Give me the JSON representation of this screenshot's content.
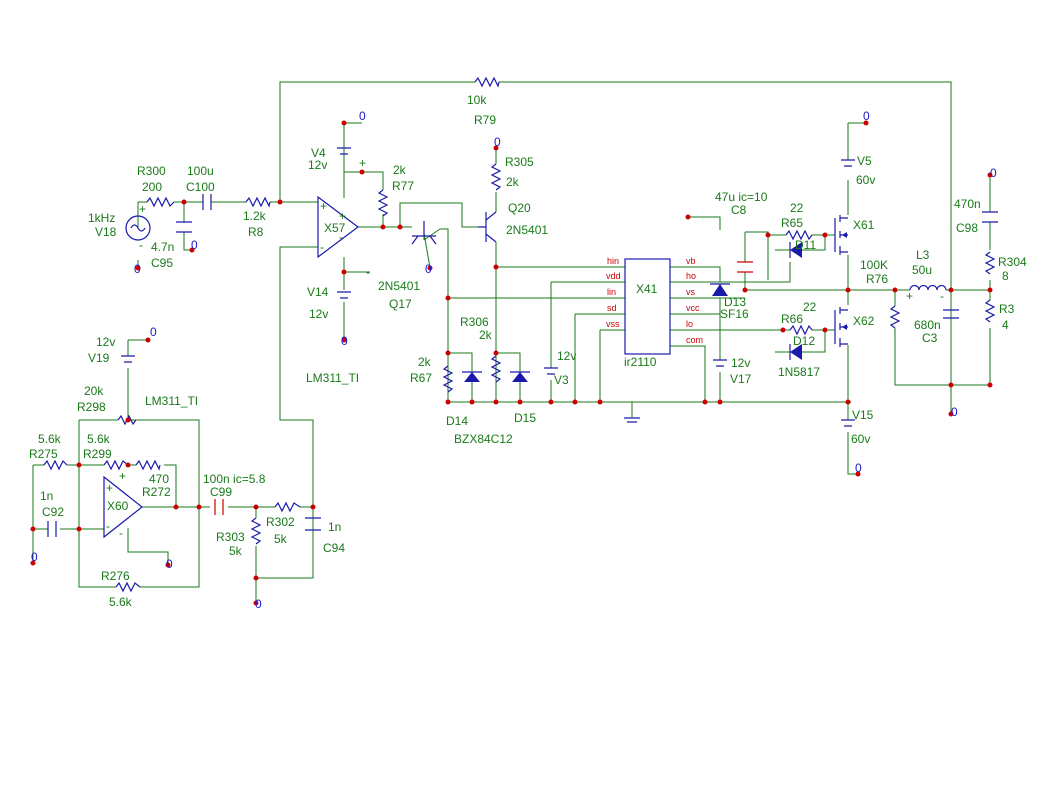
{
  "colors": {
    "wire": "#1a7a1a",
    "component": "#1a1aaa",
    "node": "#cc0000",
    "ground": "#1a1acc",
    "background": "#ffffff"
  },
  "labels": {
    "r300": "R300",
    "r300_val": "200",
    "c100_val": "100u",
    "c100": "C100",
    "v18_val": "1kHz",
    "v18": "V18",
    "c95_val": "4.7n",
    "c95": "C95",
    "r8_val": "1.2k",
    "r8": "R8",
    "v4": "V4",
    "v4_val": "12v",
    "v14": "V14",
    "v14_val": "12v",
    "r77_val": "2k",
    "r77": "R77",
    "x57": "X57",
    "lm311a": "LM311_TI",
    "r79_val": "10k",
    "r79": "R79",
    "r305": "R305",
    "r305_val": "2k",
    "q20": "Q20",
    "q20_val": "2N5401",
    "q17_val": "2N5401",
    "q17": "Q17",
    "r306": "R306",
    "r306_val": "2k",
    "r67_val": "2k",
    "r67": "R67",
    "d14": "D14",
    "d15": "D15",
    "bzx": "BZX84C12",
    "v3_val": "12v",
    "v3": "V3",
    "x41": "X41",
    "ir2110": "ir2110",
    "c8_val": "47u ic=10",
    "c8": "C8",
    "d13": "D13",
    "d13_val": "SF16",
    "v17_val": "12v",
    "v17": "V17",
    "r65_val": "22",
    "r65": "R65",
    "d11": "D11",
    "x61": "X61",
    "r66": "R66",
    "r66_val": "22",
    "d12": "D12",
    "d12_val": "1N5817",
    "x62": "X62",
    "v5": "V5",
    "v5_val": "60v",
    "v15": "V15",
    "v15_val": "60v",
    "r76_val": "100K",
    "r76": "R76",
    "l3": "L3",
    "l3_val": "50u",
    "c3_val": "680n",
    "c3": "C3",
    "c98_val": "470n",
    "c98": "C98",
    "r304": "R304",
    "r304_val": "8",
    "r3": "R3",
    "r3_val": "4",
    "v19_val": "12v",
    "v19": "V19",
    "r298_val": "20k",
    "r298": "R298",
    "lm311b": "LM311_TI",
    "r275_val": "5.6k",
    "r275": "R275",
    "r299_val": "5.6k",
    "r299": "R299",
    "r272_val": "470",
    "r272": "R272",
    "c92_val": "1n",
    "c92": "C92",
    "x60": "X60",
    "c99_val": "100n ic=5.8",
    "c99": "C99",
    "r303": "R303",
    "r303_val": "5k",
    "r302": "R302",
    "r302_val": "5k",
    "c94_val": "1n",
    "c94": "C94",
    "r276": "R276",
    "r276_val": "5.6k",
    "zero": "0"
  },
  "ir2110_pins": {
    "hin": "hin",
    "vdd": "vdd",
    "lin": "lin",
    "sd": "sd",
    "vss": "vss",
    "vb": "vb",
    "ho": "ho",
    "vs": "vs",
    "vcc": "vcc",
    "lo": "lo",
    "com": "com"
  },
  "opamp_marks": {
    "plus": "+",
    "minus": "-"
  }
}
